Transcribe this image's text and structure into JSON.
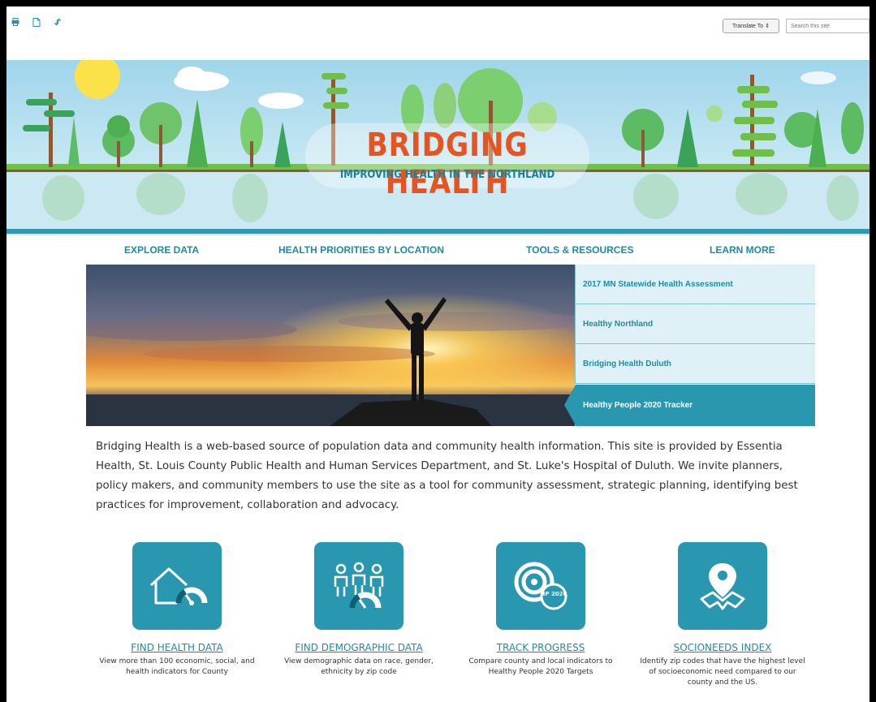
{
  "utility": {
    "icons": [
      "print-icon",
      "pdf-icon",
      "link-icon"
    ],
    "translate_label": "Translate To ⇕",
    "search_placeholder": "Search this site"
  },
  "banner": {
    "title": "BRIDGING HEALTH",
    "subtitle": "IMPROVING HEALTH IN THE NORTHLAND"
  },
  "nav": {
    "items": [
      {
        "label": "EXPLORE DATA"
      },
      {
        "label": "HEALTH PRIORITIES BY LOCATION"
      },
      {
        "label": "TOOLS & RESOURCES"
      },
      {
        "label": "LEARN MORE"
      }
    ]
  },
  "hero": {
    "links": [
      {
        "label": "2017 MN Statewide Health Assessment",
        "active": false
      },
      {
        "label": "Healthy Northland",
        "active": false
      },
      {
        "label": "Bridging Health Duluth",
        "active": false
      },
      {
        "label": "Healthy People 2020 Tracker",
        "active": true
      }
    ]
  },
  "intro": {
    "text": "Bridging Health is a web-based source of population data and community health information. This site is provided by Essentia Health, St. Louis County Public Health and Human Services Department, and St. Luke's Hospital of Duluth. We invite planners, policy makers, and community members to use the site as a tool for community assessment, strategic planning, identifying best practices for improvement, collaboration and advocacy."
  },
  "features": [
    {
      "icon": "house-gauge-icon",
      "title": "FIND HEALTH DATA",
      "desc": "View more than 100 economic, social, and health indicators for County"
    },
    {
      "icon": "people-gauge-icon",
      "title": "FIND DEMOGRAPHIC DATA",
      "desc": "View demographic data on race, gender, ethnicity by zip code"
    },
    {
      "icon": "target-hp2020-icon",
      "title": "TRACK PROGRESS",
      "desc": "Compare county and local indicators to Healthy People 2020 Targets",
      "badge": "HP 2020"
    },
    {
      "icon": "map-pin-icon",
      "title": "SOCIONEEDS INDEX",
      "desc": "Identify zip codes that have the highest level of socioeconomic need compared to our county and the US."
    }
  ],
  "colors": {
    "accent": "#2a97b0",
    "link": "#1f8aa5",
    "title_orange": "#e8541f",
    "sky": "#9fd5ea"
  }
}
